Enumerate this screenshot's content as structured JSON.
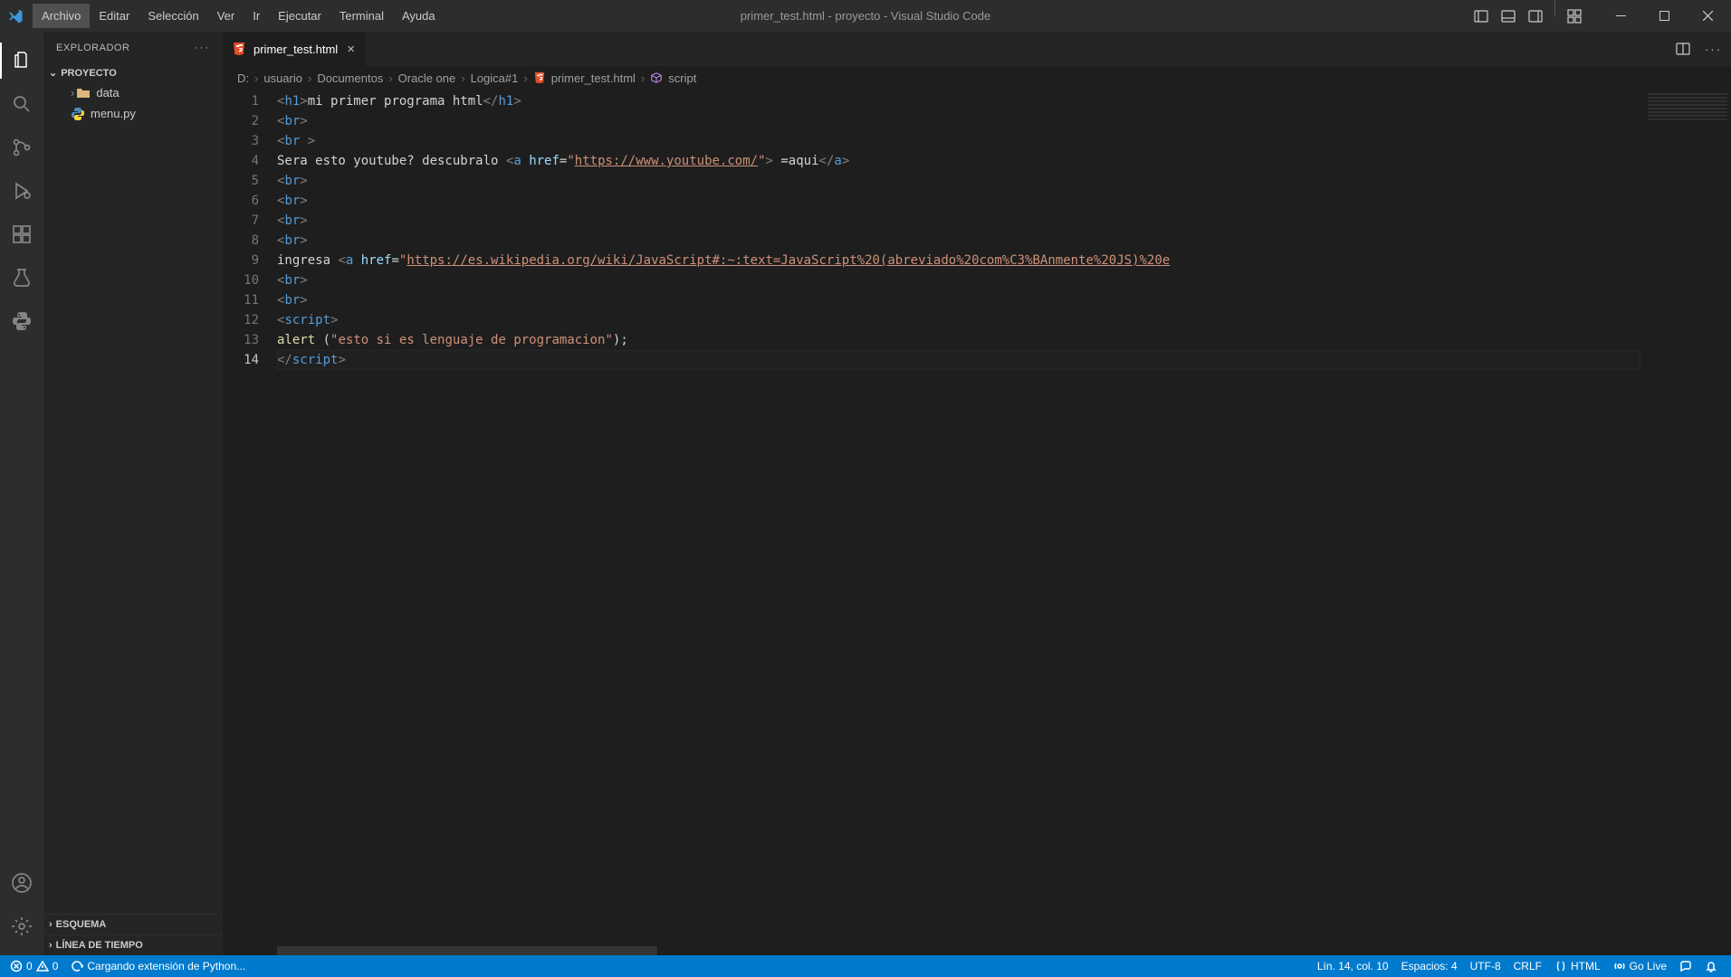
{
  "titlebar": {
    "title": "primer_test.html - proyecto - Visual Studio Code",
    "menu": [
      "Archivo",
      "Editar",
      "Selección",
      "Ver",
      "Ir",
      "Ejecutar",
      "Terminal",
      "Ayuda"
    ],
    "active_menu_index": 0
  },
  "sidebar": {
    "header": "EXPLORADOR",
    "project": "PROYECTO",
    "items": [
      {
        "name": "data",
        "type": "folder"
      },
      {
        "name": "menu.py",
        "type": "py"
      }
    ],
    "sections": {
      "outline": "ESQUEMA",
      "timeline": "LÍNEA DE TIEMPO"
    }
  },
  "tabs": [
    {
      "label": "primer_test.html",
      "icon": "html5"
    }
  ],
  "breadcrumbs": {
    "items": [
      "D:",
      "usuario",
      "Documentos",
      "Oracle one",
      "Logica#1"
    ],
    "file": "primer_test.html",
    "symbol": "script"
  },
  "editor": {
    "current_line": 14,
    "line_numbers": [
      1,
      2,
      3,
      4,
      5,
      6,
      7,
      8,
      9,
      10,
      11,
      12,
      13,
      14
    ],
    "lines": {
      "1": {
        "parts": [
          {
            "cls": "t-brk",
            "t": "<"
          },
          {
            "cls": "t-tag",
            "t": "h1"
          },
          {
            "cls": "t-brk",
            "t": ">"
          },
          {
            "cls": "t-txt",
            "t": "mi primer programa html"
          },
          {
            "cls": "t-brk",
            "t": "</"
          },
          {
            "cls": "t-tag",
            "t": "h1"
          },
          {
            "cls": "t-brk",
            "t": ">"
          }
        ]
      },
      "2": {
        "parts": [
          {
            "cls": "t-brk",
            "t": "<"
          },
          {
            "cls": "t-tag",
            "t": "br"
          },
          {
            "cls": "t-brk",
            "t": ">"
          }
        ]
      },
      "3": {
        "parts": [
          {
            "cls": "t-brk",
            "t": "<"
          },
          {
            "cls": "t-tag",
            "t": "br"
          },
          {
            "cls": "t-txt",
            "t": " "
          },
          {
            "cls": "t-brk",
            "t": ">"
          }
        ]
      },
      "4": {
        "parts": [
          {
            "cls": "t-txt",
            "t": "Sera esto youtube? descubralo "
          },
          {
            "cls": "t-brk",
            "t": "<"
          },
          {
            "cls": "t-tag",
            "t": "a"
          },
          {
            "cls": "t-txt",
            "t": " "
          },
          {
            "cls": "t-attr",
            "t": "href"
          },
          {
            "cls": "t-op",
            "t": "="
          },
          {
            "cls": "t-str",
            "t": "\""
          },
          {
            "cls": "t-link",
            "t": "https://www.youtube.com/"
          },
          {
            "cls": "t-str",
            "t": "\""
          },
          {
            "cls": "t-brk",
            "t": ">"
          },
          {
            "cls": "t-txt",
            "t": " =aqui"
          },
          {
            "cls": "t-brk",
            "t": "</"
          },
          {
            "cls": "t-tag",
            "t": "a"
          },
          {
            "cls": "t-brk",
            "t": ">"
          }
        ]
      },
      "5": {
        "parts": [
          {
            "cls": "t-brk",
            "t": "<"
          },
          {
            "cls": "t-tag",
            "t": "br"
          },
          {
            "cls": "t-brk",
            "t": ">"
          }
        ]
      },
      "6": {
        "parts": [
          {
            "cls": "t-brk",
            "t": "<"
          },
          {
            "cls": "t-tag",
            "t": "br"
          },
          {
            "cls": "t-brk",
            "t": ">"
          }
        ]
      },
      "7": {
        "parts": [
          {
            "cls": "t-brk",
            "t": "<"
          },
          {
            "cls": "t-tag",
            "t": "br"
          },
          {
            "cls": "t-brk",
            "t": ">"
          }
        ]
      },
      "8": {
        "parts": [
          {
            "cls": "t-brk",
            "t": "<"
          },
          {
            "cls": "t-tag",
            "t": "br"
          },
          {
            "cls": "t-brk",
            "t": ">"
          }
        ]
      },
      "9": {
        "parts": [
          {
            "cls": "t-txt",
            "t": "ingresa "
          },
          {
            "cls": "t-brk",
            "t": "<"
          },
          {
            "cls": "t-tag",
            "t": "a"
          },
          {
            "cls": "t-txt",
            "t": " "
          },
          {
            "cls": "t-attr",
            "t": "href"
          },
          {
            "cls": "t-op",
            "t": "="
          },
          {
            "cls": "t-str",
            "t": "\""
          },
          {
            "cls": "t-link",
            "t": "https://es.wikipedia.org/wiki/JavaScript#:~:text=JavaScript%20(abreviado%20com%C3%BAnmente%20JS)%20e"
          }
        ]
      },
      "10": {
        "parts": [
          {
            "cls": "t-brk",
            "t": "<"
          },
          {
            "cls": "t-tag",
            "t": "br"
          },
          {
            "cls": "t-brk",
            "t": ">"
          }
        ]
      },
      "11": {
        "parts": [
          {
            "cls": "t-brk",
            "t": "<"
          },
          {
            "cls": "t-tag",
            "t": "br"
          },
          {
            "cls": "t-brk",
            "t": ">"
          }
        ]
      },
      "12": {
        "parts": [
          {
            "cls": "t-brk",
            "t": "<"
          },
          {
            "cls": "t-tag",
            "t": "script"
          },
          {
            "cls": "t-brk",
            "t": ">"
          }
        ]
      },
      "13": {
        "parts": [
          {
            "cls": "t-fn",
            "t": "alert"
          },
          {
            "cls": "t-txt",
            "t": " "
          },
          {
            "cls": "t-op",
            "t": "("
          },
          {
            "cls": "t-str",
            "t": "\"esto si es lenguaje de programacion\""
          },
          {
            "cls": "t-op",
            "t": ");"
          }
        ]
      },
      "14": {
        "parts": [
          {
            "cls": "t-brk",
            "t": "</"
          },
          {
            "cls": "t-tag",
            "t": "script"
          },
          {
            "cls": "t-brk",
            "t": ">"
          }
        ]
      }
    }
  },
  "statusbar": {
    "errors": "0",
    "warnings": "0",
    "loading": "Cargando extensión de Python...",
    "cursor": "Lín. 14, col. 10",
    "spaces": "Espacios: 4",
    "encoding": "UTF-8",
    "eol": "CRLF",
    "language": "HTML",
    "golive": "Go Live"
  }
}
